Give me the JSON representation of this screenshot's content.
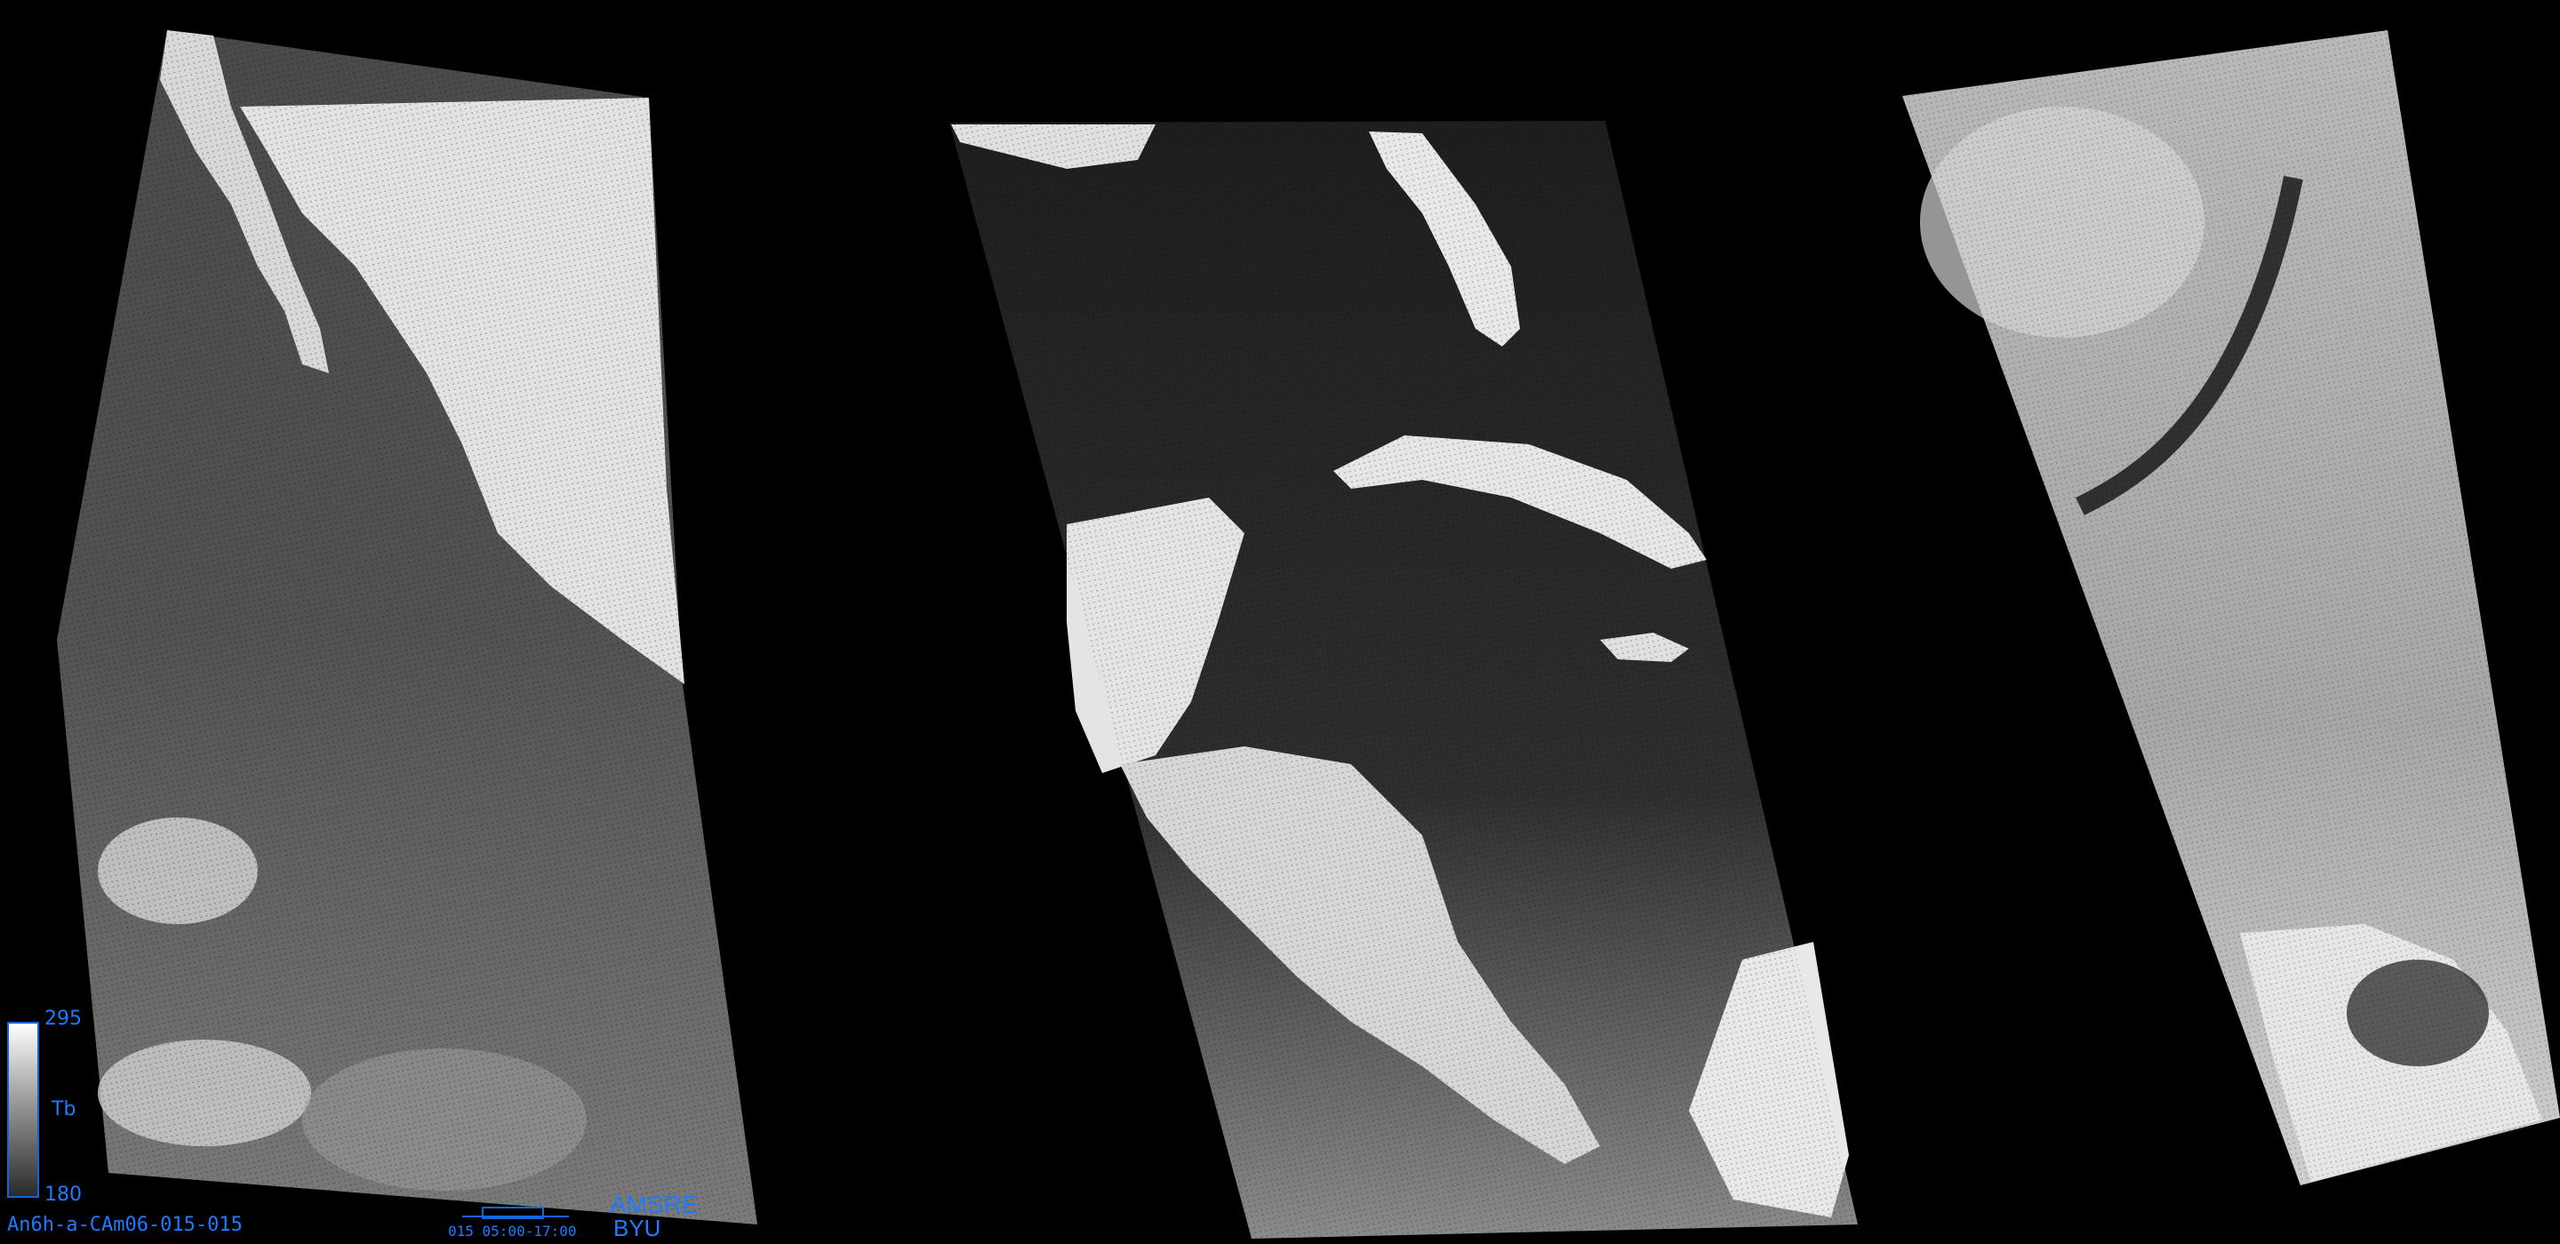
{
  "image": {
    "caption": "An6h-a-CAm06-015-015",
    "sensor": "AMSRE",
    "organization": "BYU",
    "time_label": "015  05:00-17:00"
  },
  "colorbar": {
    "max": "295",
    "unit": "Tb",
    "min": "180"
  },
  "colors": {
    "annotation": "#1e7bff",
    "ocean": "#3a3a3a",
    "land": "#e4e4e4",
    "background": "#000000"
  }
}
